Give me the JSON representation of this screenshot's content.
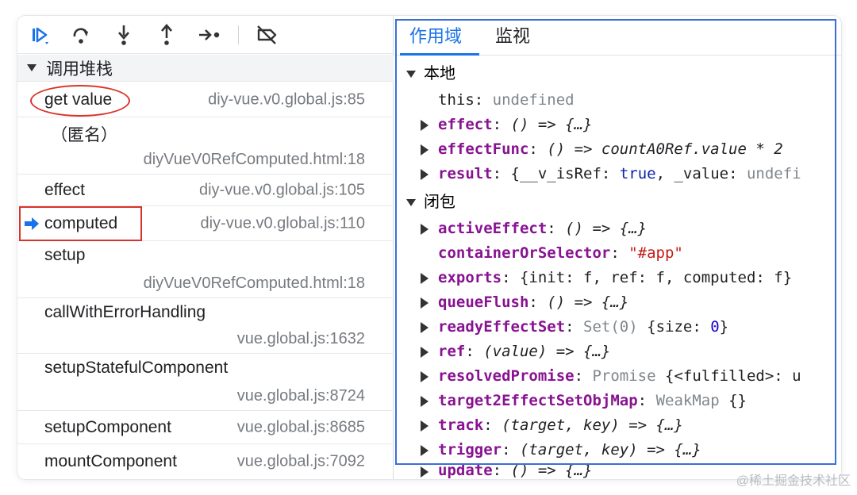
{
  "toolbar": {
    "buttons": [
      {
        "name": "resume-icon",
        "label": "resume"
      },
      {
        "name": "step-over-icon",
        "label": "step over"
      },
      {
        "name": "step-into-icon",
        "label": "step into"
      },
      {
        "name": "step-out-icon",
        "label": "step out"
      },
      {
        "name": "step-icon",
        "label": "step"
      },
      {
        "name": "deactivate-breakpoints-icon",
        "label": "deactivate breakpoints"
      }
    ]
  },
  "call_stack": {
    "title": "调用堆栈",
    "frames": [
      {
        "name": "get value",
        "location": "diy-vue.v0.global.js:85"
      },
      {
        "name": "（匿名）",
        "location": "diyVueV0RefComputed.html:18"
      },
      {
        "name": "effect",
        "location": "diy-vue.v0.global.js:105"
      },
      {
        "name": "computed",
        "location": "diy-vue.v0.global.js:110",
        "current": true
      },
      {
        "name": "setup",
        "location": "diyVueV0RefComputed.html:18"
      },
      {
        "name": "callWithErrorHandling",
        "location": "vue.global.js:1632"
      },
      {
        "name": "setupStatefulComponent",
        "location": "vue.global.js:8724"
      },
      {
        "name": "setupComponent",
        "location": "vue.global.js:8685"
      },
      {
        "name": "mountComponent",
        "location": "vue.global.js:7092"
      }
    ]
  },
  "tabs": [
    {
      "label": "作用域",
      "active": true
    },
    {
      "label": "监视",
      "active": false
    }
  ],
  "scope": {
    "local_title": "本地",
    "local": [
      {
        "key": "this",
        "sep": ": ",
        "value": "undefined"
      },
      {
        "key": "effect",
        "sep": ": ",
        "value": "() => {…}"
      },
      {
        "key": "effectFunc",
        "sep": ": ",
        "value": "() => countA0Ref.value * 2"
      },
      {
        "key": "result",
        "sep": ": ",
        "v1": "{__v_isRef",
        "v2": ": ",
        "v3": "true",
        "v4": ", _value: ",
        "v5": "undefi"
      }
    ],
    "closure_title": "闭包",
    "closure": [
      {
        "key": "activeEffect",
        "sep": ": ",
        "value": "() => {…}"
      },
      {
        "key": "containerOrSelector",
        "sep": ": ",
        "value": "\"#app\""
      },
      {
        "key": "exports",
        "sep": ": ",
        "value": "{init: f, ref: f, computed: f}"
      },
      {
        "key": "queueFlush",
        "sep": ": ",
        "value": "() => {…}"
      },
      {
        "key": "readyEffectSet",
        "sep": ": ",
        "value_a": "Set(0) ",
        "value_b": "{size: ",
        "value_c": "0",
        "value_d": "}"
      },
      {
        "key": "ref",
        "sep": ": ",
        "value": "(value) => {…}"
      },
      {
        "key": "resolvedPromise",
        "sep": ": ",
        "value_a": "Promise ",
        "value_b": "{<fulfilled>: u"
      },
      {
        "key": "target2EffectSetObjMap",
        "sep": ": ",
        "value_a": "WeakMap ",
        "value_b": "{}"
      },
      {
        "key": "track",
        "sep": ": ",
        "value": "(target, key) => {…}"
      },
      {
        "key": "trigger",
        "sep": ": ",
        "value": "(target, key) => {…}"
      },
      {
        "key": "update",
        "sep": ": ",
        "value": "() => {…}"
      }
    ]
  },
  "watermark": "@稀土掘金技术社区",
  "colors": {
    "accent": "#1a73e8",
    "highlight": "#d9342b",
    "property": "#881391",
    "string": "#c41a16"
  }
}
